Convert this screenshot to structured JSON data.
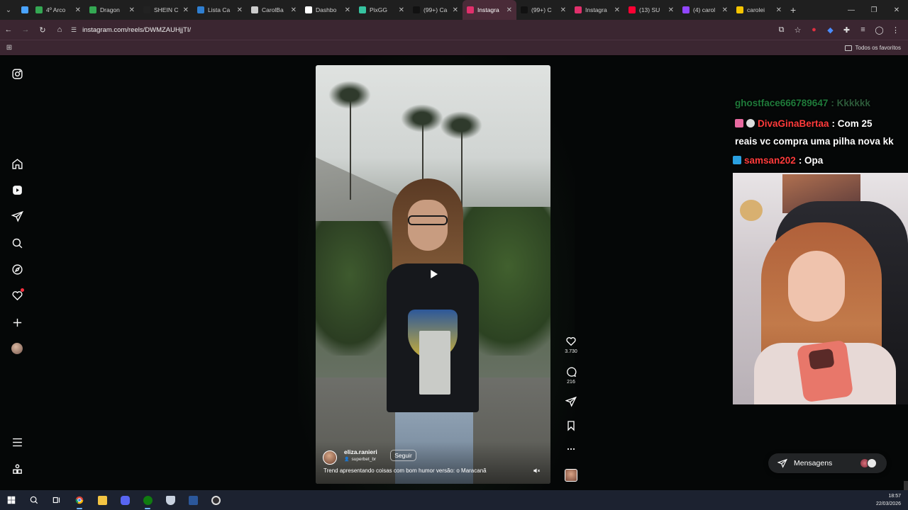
{
  "browser": {
    "tabs": [
      {
        "label": "",
        "favicon_color": "#4aa3ff"
      },
      {
        "label": "4º Arco",
        "favicon_color": "#34a853"
      },
      {
        "label": "Dragon",
        "favicon_color": "#34a853"
      },
      {
        "label": "SHEIN C",
        "favicon_color": "#222222"
      },
      {
        "label": "Lista Ca",
        "favicon_color": "#2f7fd1"
      },
      {
        "label": "CarolBa",
        "favicon_color": "#cccccc"
      },
      {
        "label": "Dashbo",
        "favicon_color": "#ffffff"
      },
      {
        "label": "PixGG",
        "favicon_color": "#36c3a0"
      },
      {
        "label": "(99+) Ca",
        "favicon_color": "#111111"
      },
      {
        "label": "Instagra",
        "favicon_color": "#e1306c",
        "active": true
      },
      {
        "label": "(99+) C",
        "favicon_color": "#111111"
      },
      {
        "label": "Instagra",
        "favicon_color": "#e1306c"
      },
      {
        "label": "(13) SU",
        "favicon_color": "#ff0033"
      },
      {
        "label": "(4) carol",
        "favicon_color": "#9146ff"
      },
      {
        "label": "carolei",
        "favicon_color": "#f5c400"
      }
    ],
    "url": "instagram.com/reels/DWMZAUHjjTI/",
    "bookmarks_label": "Todos os favoritos"
  },
  "reel": {
    "username": "eliza.ranieri",
    "sub_label": "superbet_br",
    "follow_label": "Seguir",
    "caption": "Trend apresentando coisas com bom humor versão: o Maracanã",
    "likes": "3.730",
    "comments": "216"
  },
  "chat": [
    {
      "user": "ghostface666789647",
      "text": ": Kkkkkk",
      "user_color": "#1f7a3a",
      "text_color": "#2d5a3a",
      "icons": []
    },
    {
      "user": "DivaGinaBertaa",
      "text": ": Com 25",
      "user_color": "#ff3b3b",
      "text_color": "#ffffff",
      "icons": [
        "#e86aa0",
        "#dddddd"
      ]
    },
    {
      "user": "",
      "text": "reais vc compra uma pilha nova kk",
      "user_color": "#ffffff",
      "text_color": "#ffffff",
      "icons": []
    },
    {
      "user": "samsan202",
      "text": ": Opa",
      "user_color": "#ff3b3b",
      "text_color": "#ffffff",
      "icons": [
        "#2aa0e0"
      ]
    }
  ],
  "messages": {
    "label": "Mensagens"
  },
  "taskbar": {
    "time": "18:57",
    "date": "22/03/2026"
  }
}
